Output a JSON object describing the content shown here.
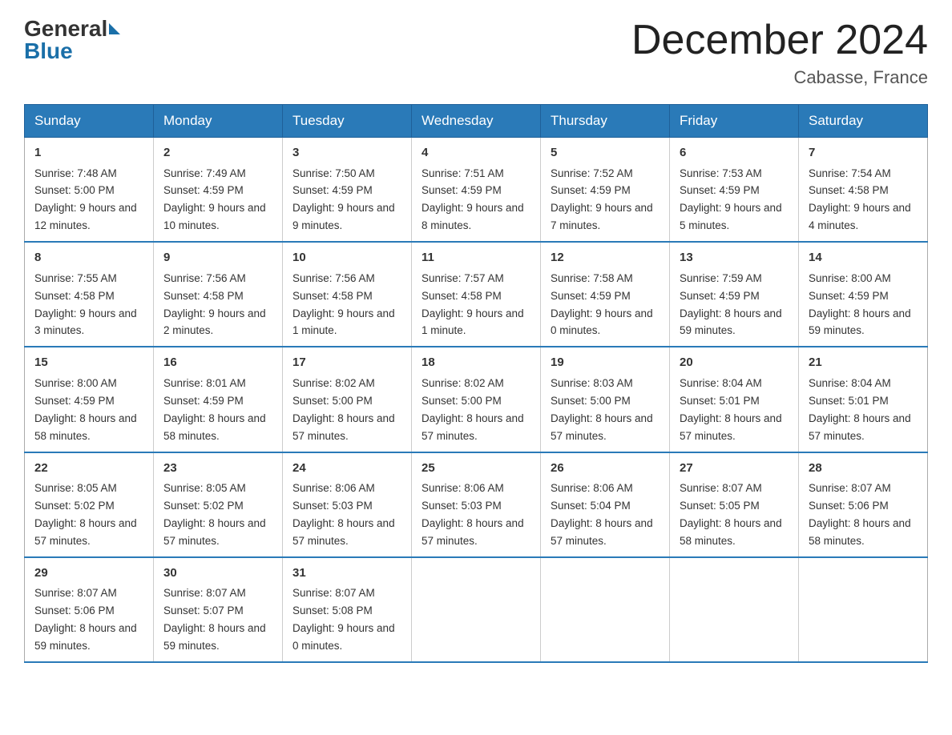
{
  "header": {
    "logo_general": "General",
    "logo_blue": "Blue",
    "month_title": "December 2024",
    "location": "Cabasse, France"
  },
  "days_of_week": [
    "Sunday",
    "Monday",
    "Tuesday",
    "Wednesday",
    "Thursday",
    "Friday",
    "Saturday"
  ],
  "weeks": [
    [
      {
        "day": "1",
        "sunrise": "7:48 AM",
        "sunset": "5:00 PM",
        "daylight": "9 hours and 12 minutes."
      },
      {
        "day": "2",
        "sunrise": "7:49 AM",
        "sunset": "4:59 PM",
        "daylight": "9 hours and 10 minutes."
      },
      {
        "day": "3",
        "sunrise": "7:50 AM",
        "sunset": "4:59 PM",
        "daylight": "9 hours and 9 minutes."
      },
      {
        "day": "4",
        "sunrise": "7:51 AM",
        "sunset": "4:59 PM",
        "daylight": "9 hours and 8 minutes."
      },
      {
        "day": "5",
        "sunrise": "7:52 AM",
        "sunset": "4:59 PM",
        "daylight": "9 hours and 7 minutes."
      },
      {
        "day": "6",
        "sunrise": "7:53 AM",
        "sunset": "4:59 PM",
        "daylight": "9 hours and 5 minutes."
      },
      {
        "day": "7",
        "sunrise": "7:54 AM",
        "sunset": "4:58 PM",
        "daylight": "9 hours and 4 minutes."
      }
    ],
    [
      {
        "day": "8",
        "sunrise": "7:55 AM",
        "sunset": "4:58 PM",
        "daylight": "9 hours and 3 minutes."
      },
      {
        "day": "9",
        "sunrise": "7:56 AM",
        "sunset": "4:58 PM",
        "daylight": "9 hours and 2 minutes."
      },
      {
        "day": "10",
        "sunrise": "7:56 AM",
        "sunset": "4:58 PM",
        "daylight": "9 hours and 1 minute."
      },
      {
        "day": "11",
        "sunrise": "7:57 AM",
        "sunset": "4:58 PM",
        "daylight": "9 hours and 1 minute."
      },
      {
        "day": "12",
        "sunrise": "7:58 AM",
        "sunset": "4:59 PM",
        "daylight": "9 hours and 0 minutes."
      },
      {
        "day": "13",
        "sunrise": "7:59 AM",
        "sunset": "4:59 PM",
        "daylight": "8 hours and 59 minutes."
      },
      {
        "day": "14",
        "sunrise": "8:00 AM",
        "sunset": "4:59 PM",
        "daylight": "8 hours and 59 minutes."
      }
    ],
    [
      {
        "day": "15",
        "sunrise": "8:00 AM",
        "sunset": "4:59 PM",
        "daylight": "8 hours and 58 minutes."
      },
      {
        "day": "16",
        "sunrise": "8:01 AM",
        "sunset": "4:59 PM",
        "daylight": "8 hours and 58 minutes."
      },
      {
        "day": "17",
        "sunrise": "8:02 AM",
        "sunset": "5:00 PM",
        "daylight": "8 hours and 57 minutes."
      },
      {
        "day": "18",
        "sunrise": "8:02 AM",
        "sunset": "5:00 PM",
        "daylight": "8 hours and 57 minutes."
      },
      {
        "day": "19",
        "sunrise": "8:03 AM",
        "sunset": "5:00 PM",
        "daylight": "8 hours and 57 minutes."
      },
      {
        "day": "20",
        "sunrise": "8:04 AM",
        "sunset": "5:01 PM",
        "daylight": "8 hours and 57 minutes."
      },
      {
        "day": "21",
        "sunrise": "8:04 AM",
        "sunset": "5:01 PM",
        "daylight": "8 hours and 57 minutes."
      }
    ],
    [
      {
        "day": "22",
        "sunrise": "8:05 AM",
        "sunset": "5:02 PM",
        "daylight": "8 hours and 57 minutes."
      },
      {
        "day": "23",
        "sunrise": "8:05 AM",
        "sunset": "5:02 PM",
        "daylight": "8 hours and 57 minutes."
      },
      {
        "day": "24",
        "sunrise": "8:06 AM",
        "sunset": "5:03 PM",
        "daylight": "8 hours and 57 minutes."
      },
      {
        "day": "25",
        "sunrise": "8:06 AM",
        "sunset": "5:03 PM",
        "daylight": "8 hours and 57 minutes."
      },
      {
        "day": "26",
        "sunrise": "8:06 AM",
        "sunset": "5:04 PM",
        "daylight": "8 hours and 57 minutes."
      },
      {
        "day": "27",
        "sunrise": "8:07 AM",
        "sunset": "5:05 PM",
        "daylight": "8 hours and 58 minutes."
      },
      {
        "day": "28",
        "sunrise": "8:07 AM",
        "sunset": "5:06 PM",
        "daylight": "8 hours and 58 minutes."
      }
    ],
    [
      {
        "day": "29",
        "sunrise": "8:07 AM",
        "sunset": "5:06 PM",
        "daylight": "8 hours and 59 minutes."
      },
      {
        "day": "30",
        "sunrise": "8:07 AM",
        "sunset": "5:07 PM",
        "daylight": "8 hours and 59 minutes."
      },
      {
        "day": "31",
        "sunrise": "8:07 AM",
        "sunset": "5:08 PM",
        "daylight": "9 hours and 0 minutes."
      },
      null,
      null,
      null,
      null
    ]
  ]
}
